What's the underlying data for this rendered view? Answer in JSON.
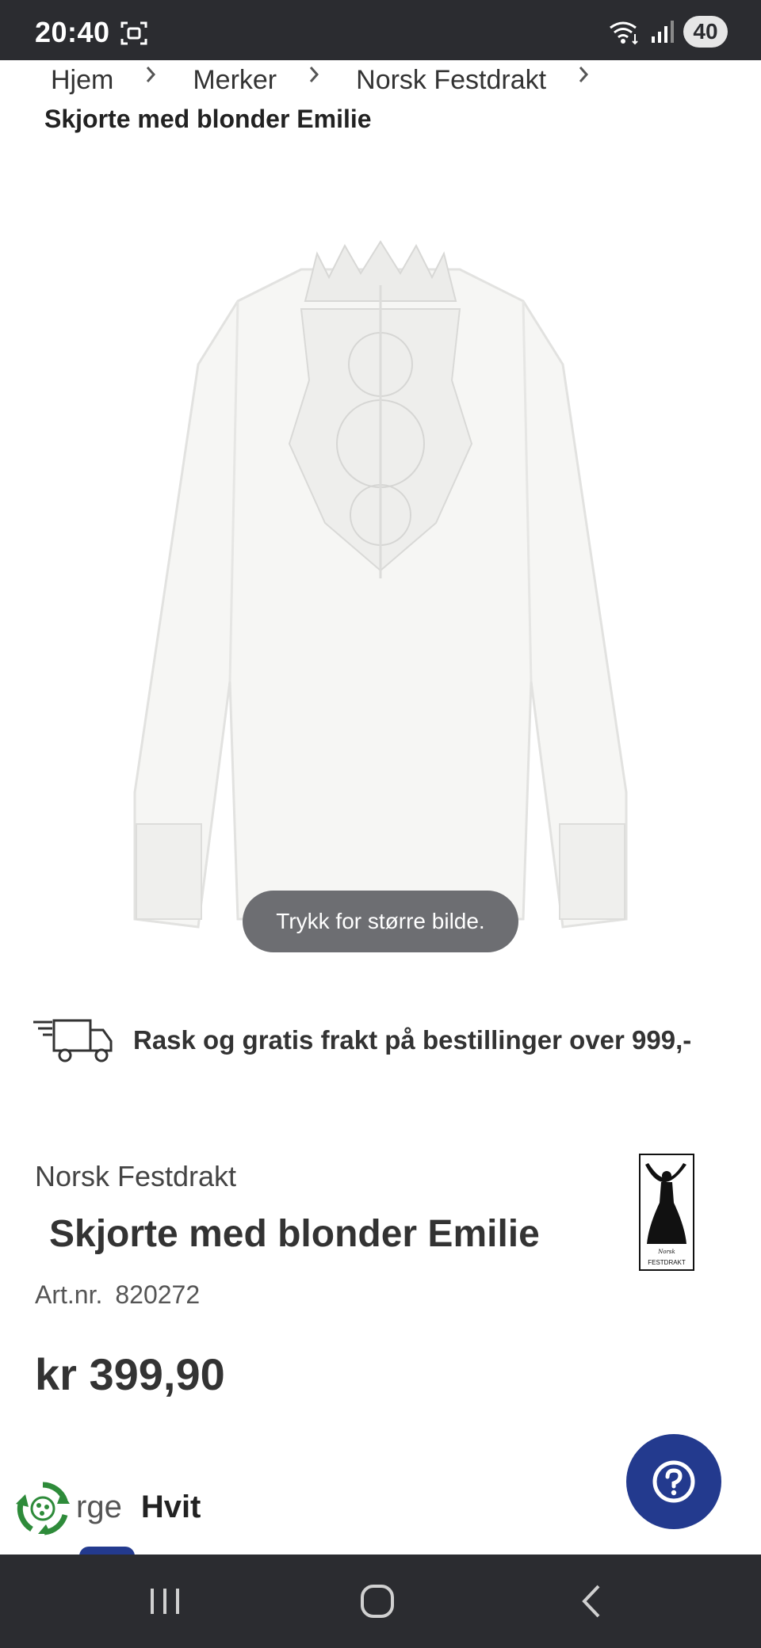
{
  "status_bar": {
    "time": "20:40",
    "battery": "40",
    "icons": [
      "screenshot-icon",
      "wifi-icon",
      "signal-icon"
    ]
  },
  "breadcrumb": {
    "items": [
      "Hjem",
      "Merker",
      "Norsk Festdrakt"
    ],
    "current": "Skjorte med blonder Emilie"
  },
  "image": {
    "zoom_hint": "Trykk for større bilde."
  },
  "shipping": {
    "text": "Rask og gratis frakt på bestillinger over 999,-"
  },
  "product": {
    "brand": "Norsk Festdrakt",
    "title": "Skjorte med blonder Emilie",
    "artnr_label": "Art.nr.",
    "artnr_value": "820272",
    "price": "kr 399,90",
    "color_label_partial": "rge",
    "color_value": "Hvit",
    "brand_logo_text_top": "Norsk",
    "brand_logo_text_bottom": "FESTDRAKT"
  },
  "colors": {
    "status_bg": "#2b2c30",
    "accent": "#233a8e",
    "recycle": "#2e8b3a"
  }
}
